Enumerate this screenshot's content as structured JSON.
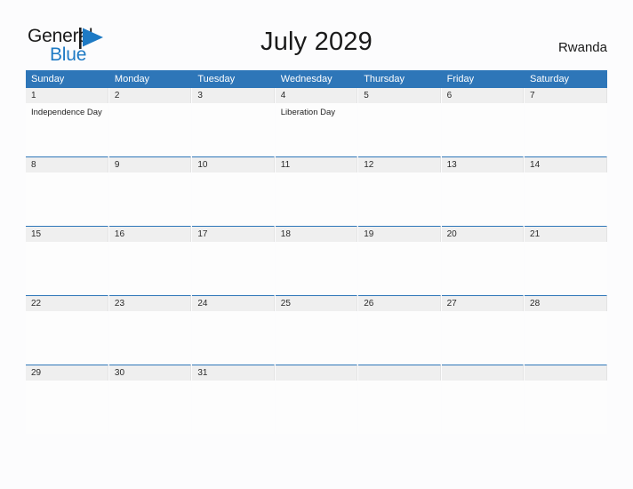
{
  "brand": {
    "name_part1": "General",
    "name_part2": "Blue",
    "flag_icon": "flag-icon",
    "accent_color": "#1e7ac4"
  },
  "header": {
    "title": "July 2029",
    "country": "Rwanda"
  },
  "theme": {
    "header_blue": "#2e76b8",
    "row_gray": "#efefef",
    "page_background": "#fcfcfd",
    "text_color": "#1a1a1a"
  },
  "calendar": {
    "month": "July",
    "year": "2029",
    "weekday_headers": [
      "Sunday",
      "Monday",
      "Tuesday",
      "Wednesday",
      "Thursday",
      "Friday",
      "Saturday"
    ],
    "weeks": [
      [
        {
          "day": "1",
          "events": [
            "Independence Day"
          ]
        },
        {
          "day": "2",
          "events": []
        },
        {
          "day": "3",
          "events": []
        },
        {
          "day": "4",
          "events": [
            "Liberation Day"
          ]
        },
        {
          "day": "5",
          "events": []
        },
        {
          "day": "6",
          "events": []
        },
        {
          "day": "7",
          "events": []
        }
      ],
      [
        {
          "day": "8",
          "events": []
        },
        {
          "day": "9",
          "events": []
        },
        {
          "day": "10",
          "events": []
        },
        {
          "day": "11",
          "events": []
        },
        {
          "day": "12",
          "events": []
        },
        {
          "day": "13",
          "events": []
        },
        {
          "day": "14",
          "events": []
        }
      ],
      [
        {
          "day": "15",
          "events": []
        },
        {
          "day": "16",
          "events": []
        },
        {
          "day": "17",
          "events": []
        },
        {
          "day": "18",
          "events": []
        },
        {
          "day": "19",
          "events": []
        },
        {
          "day": "20",
          "events": []
        },
        {
          "day": "21",
          "events": []
        }
      ],
      [
        {
          "day": "22",
          "events": []
        },
        {
          "day": "23",
          "events": []
        },
        {
          "day": "24",
          "events": []
        },
        {
          "day": "25",
          "events": []
        },
        {
          "day": "26",
          "events": []
        },
        {
          "day": "27",
          "events": []
        },
        {
          "day": "28",
          "events": []
        }
      ],
      [
        {
          "day": "29",
          "events": []
        },
        {
          "day": "30",
          "events": []
        },
        {
          "day": "31",
          "events": []
        },
        {
          "day": "",
          "events": []
        },
        {
          "day": "",
          "events": []
        },
        {
          "day": "",
          "events": []
        },
        {
          "day": "",
          "events": []
        }
      ]
    ]
  }
}
